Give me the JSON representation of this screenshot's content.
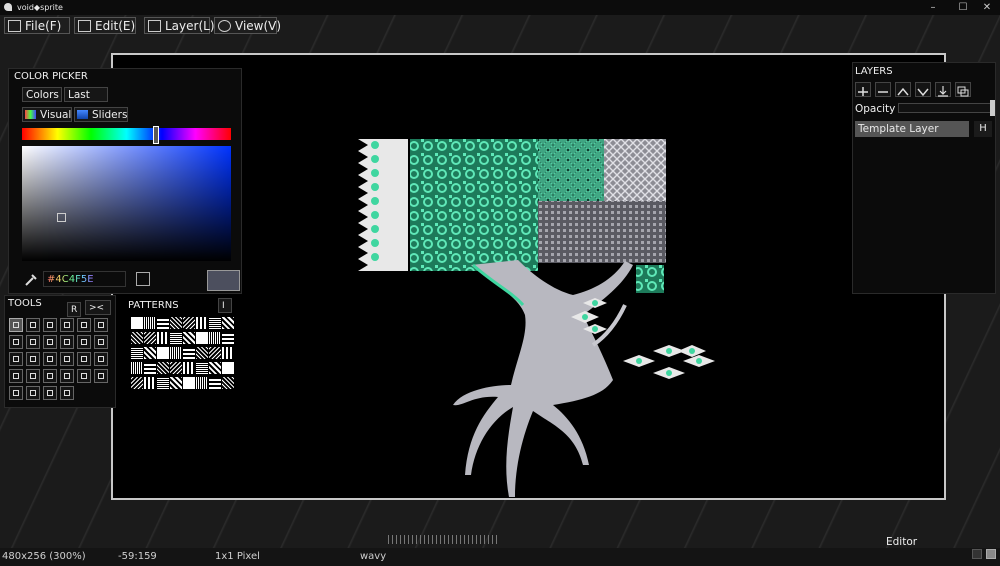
{
  "window": {
    "title": "void◆sprite",
    "minimize": "–",
    "maximize": "☐",
    "close": "✕"
  },
  "menu": [
    {
      "label": "File(F)",
      "icon": "image-icon"
    },
    {
      "label": "Edit(E)",
      "icon": "edit-icon"
    },
    {
      "label": "Layer(L)",
      "icon": "layers-icon"
    },
    {
      "label": "View(V)",
      "icon": "eye-icon"
    }
  ],
  "color_picker": {
    "title": "COLOR PICKER",
    "tabs": [
      "Colors",
      "Last"
    ],
    "modes": [
      "Visual",
      "Sliders"
    ],
    "hex_value": "#4C4F5E",
    "current_color": "#4C4F5E",
    "hue_fraction": 0.63
  },
  "tools": {
    "title": "TOOLS",
    "r_label": "R",
    "toggle_label": "><"
  },
  "patterns": {
    "title": "PATTERNS",
    "i_label": "I"
  },
  "layers": {
    "title": "LAYERS",
    "opacity_label": "Opacity",
    "opacity_value": 1.0,
    "items": [
      {
        "name": "Template Layer",
        "hide_label": "H"
      }
    ]
  },
  "status": {
    "canvas_size": "480x256 (300%)",
    "cursor_pos": "-59:159",
    "brush_size": "1x1 Pixel",
    "file_name": "wavy",
    "mode": "Editor"
  },
  "colors": {
    "accent_green": "#3fd6a0",
    "sprite_gray": "#b8b8c0"
  }
}
